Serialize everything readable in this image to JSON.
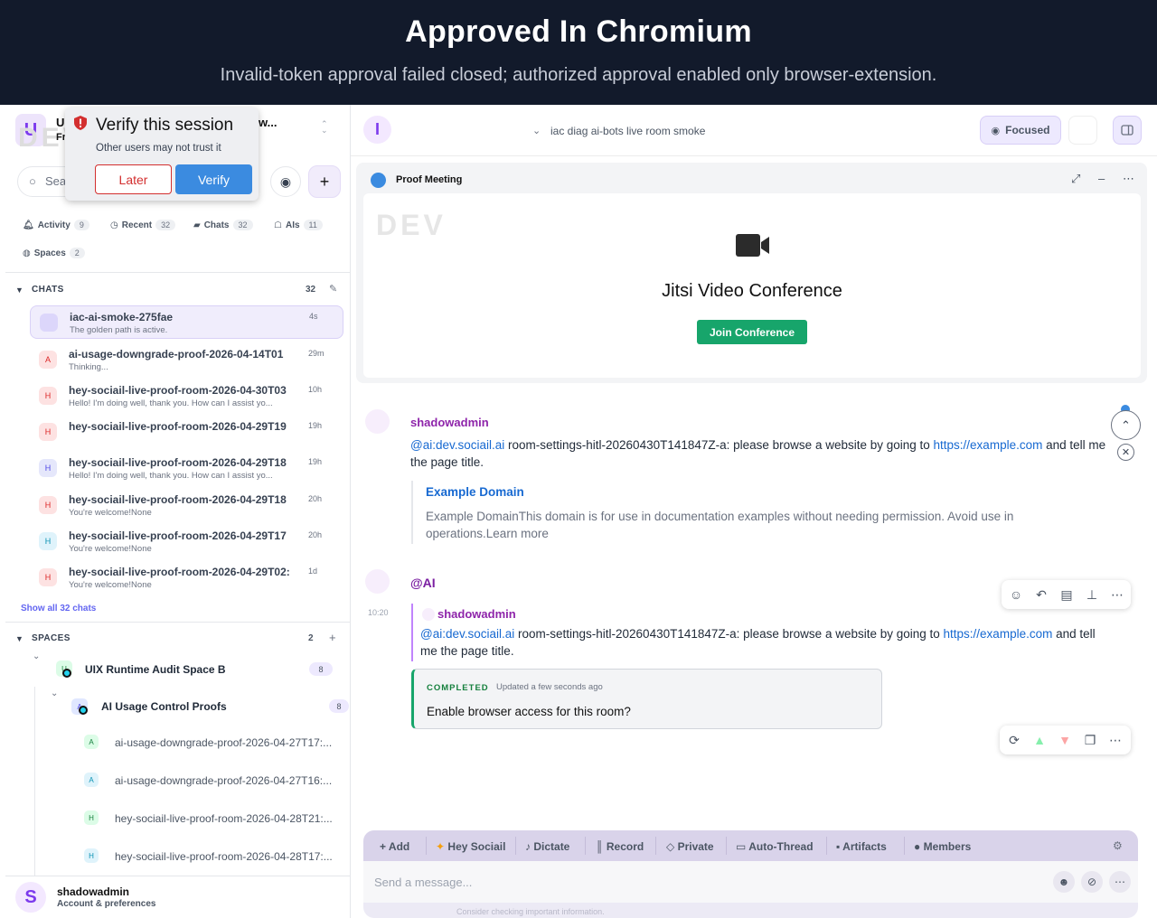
{
  "banner": {
    "title": "Approved In Chromium",
    "subtitle": "Invalid-token approval failed closed; authorized approval enabled only browser-extension."
  },
  "sidebar": {
    "workspace_initial": "U",
    "workspace_name": "U",
    "workspace_name_tail": "w...",
    "workspace_sub": "Fr",
    "dev_watermark": "DEV",
    "search_placeholder": "Sea",
    "filters": [
      {
        "label": "Activity",
        "count": "9"
      },
      {
        "label": "Recent",
        "count": "32"
      },
      {
        "label": "Chats",
        "count": "32"
      },
      {
        "label": "AIs",
        "count": "11"
      },
      {
        "label": "Spaces",
        "count": "2"
      }
    ],
    "chats_header": "CHATS",
    "chats_count": "32",
    "chats": [
      {
        "initial": "",
        "name": "iac-ai-smoke-275fae",
        "preview": "The golden path is active.",
        "time": "4s"
      },
      {
        "initial": "A",
        "name": "ai-usage-downgrade-proof-2026-04-14T01",
        "preview": "Thinking...",
        "time": "29m"
      },
      {
        "initial": "H",
        "name": "hey-sociail-live-proof-room-2026-04-30T03",
        "preview": "Hello! I'm doing well, thank you. How can I assist yo...",
        "time": "10h"
      },
      {
        "initial": "H",
        "name": "hey-sociail-live-proof-room-2026-04-29T19",
        "preview": "",
        "time": "19h"
      },
      {
        "initial": "H",
        "name": "hey-sociail-live-proof-room-2026-04-29T18",
        "preview": "Hello! I'm doing well, thank you. How can I assist yo...",
        "time": "19h"
      },
      {
        "initial": "H",
        "name": "hey-sociail-live-proof-room-2026-04-29T18",
        "preview": "You're welcome!None",
        "time": "20h"
      },
      {
        "initial": "H",
        "name": "hey-sociail-live-proof-room-2026-04-29T17",
        "preview": "You're welcome!None",
        "time": "20h"
      },
      {
        "initial": "H",
        "name": "hey-sociail-live-proof-room-2026-04-29T02:",
        "preview": "You're welcome!None",
        "time": "1d"
      }
    ],
    "show_all": "Show all 32 chats",
    "spaces_header": "SPACES",
    "spaces_count": "2",
    "spaces": [
      {
        "initial": "U",
        "name": "UIX Runtime Audit Space B",
        "count": "8"
      },
      {
        "initial": "A",
        "name": "AI Usage Control Proofs",
        "count": "8"
      }
    ],
    "space_rooms": [
      {
        "initial": "A",
        "name": "ai-usage-downgrade-proof-2026-04-27T17:..."
      },
      {
        "initial": "A",
        "name": "ai-usage-downgrade-proof-2026-04-27T16:..."
      },
      {
        "initial": "H",
        "name": "hey-sociail-live-proof-room-2026-04-28T21:..."
      },
      {
        "initial": "H",
        "name": "hey-sociail-live-proof-room-2026-04-28T17:..."
      }
    ],
    "user": {
      "initial": "S",
      "name": "shadowadmin",
      "sub": "Account & preferences"
    }
  },
  "popup": {
    "title": "Verify this session",
    "subtitle": "Other users may not trust it",
    "later": "Later",
    "verify": "Verify"
  },
  "header": {
    "room_initial": "I",
    "room_title": "iac diag ai-bots live room smoke",
    "focused": "Focused"
  },
  "meeting": {
    "title": "Proof Meeting",
    "watermark": "DEV",
    "conference_title": "Jitsi Video Conference",
    "join": "Join Conference"
  },
  "messages": {
    "m1_sender": "shadowadmin",
    "m1_mention": "@ai:dev.sociail.ai",
    "m1_text": " room-settings-hitl-20260430T141847Z-a: please browse a website by going to ",
    "m1_link": "https://example.com",
    "m1_tail": " and tell me the page title.",
    "preview_title": "Example Domain",
    "preview_desc": "Example DomainThis domain is for use in documentation examples without needing permission. Avoid use in operations.Learn more",
    "m2_sender": "@AI",
    "m2_time": "10:20",
    "quote_sender": "shadowadmin",
    "quote_mention": "@ai:dev.sociail.ai",
    "quote_text": " room-settings-hitl-20260430T141847Z-a: please browse a website by going to ",
    "quote_link": "https://example.com",
    "quote_tail": " and tell me the page title.",
    "status": "COMPLETED",
    "status_updated": "Updated a few seconds ago",
    "question": "Enable browser access for this room?"
  },
  "composer": {
    "tools": [
      "Add",
      "Hey Sociail",
      "Dictate",
      "Record",
      "Private",
      "Auto-Thread",
      "Artifacts",
      "Members"
    ],
    "placeholder": "Send a message...",
    "disclaimer": "Consider checking important information."
  },
  "colors": {
    "banner": "#121a2b",
    "accent": "#7c3aed",
    "link": "#1769d1",
    "success": "#17a56b",
    "danger": "#d32f2f",
    "primary": "#3b8be0"
  }
}
